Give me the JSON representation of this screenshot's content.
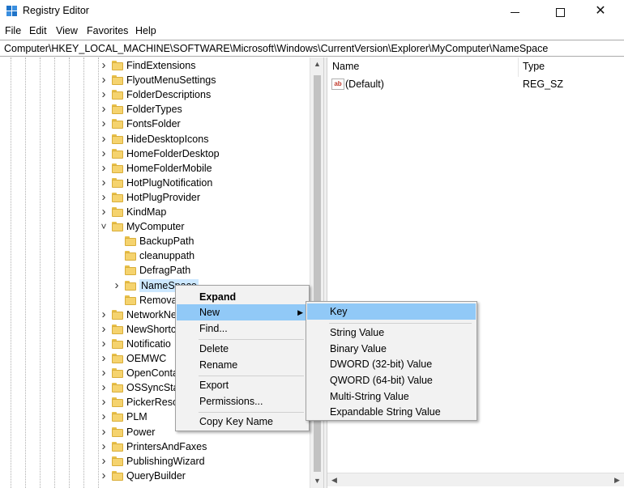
{
  "window": {
    "title": "Registry Editor",
    "minimize": "—",
    "maximize": "☐",
    "close": "✕"
  },
  "menu": [
    "File",
    "Edit",
    "View",
    "Favorites",
    "Help"
  ],
  "address": "Computer\\HKEY_LOCAL_MACHINE\\SOFTWARE\\Microsoft\\Windows\\CurrentVersion\\Explorer\\MyComputer\\NameSpace",
  "tree": {
    "items": [
      {
        "label": "FindExtensions",
        "expanded": false
      },
      {
        "label": "FlyoutMenuSettings",
        "expanded": false
      },
      {
        "label": "FolderDescriptions",
        "expanded": false
      },
      {
        "label": "FolderTypes",
        "expanded": false
      },
      {
        "label": "FontsFolder",
        "expanded": false
      },
      {
        "label": "HideDesktopIcons",
        "expanded": false
      },
      {
        "label": "HomeFolderDesktop",
        "expanded": false
      },
      {
        "label": "HomeFolderMobile",
        "expanded": false
      },
      {
        "label": "HotPlugNotification",
        "expanded": false
      },
      {
        "label": "HotPlugProvider",
        "expanded": false
      },
      {
        "label": "KindMap",
        "expanded": false
      },
      {
        "label": "MyComputer",
        "expanded": true
      },
      {
        "label": "BackupPath",
        "child": true
      },
      {
        "label": "cleanuppath",
        "child": true
      },
      {
        "label": "DefragPath",
        "child": true
      },
      {
        "label": "NameSpace",
        "child": true,
        "selected": true
      },
      {
        "label": "Remova",
        "child": true
      },
      {
        "label": "NetworkNe",
        "expanded": false
      },
      {
        "label": "NewShortc",
        "expanded": false
      },
      {
        "label": "Notificatio",
        "expanded": false
      },
      {
        "label": "OEMWC",
        "expanded": false
      },
      {
        "label": "OpenConta",
        "expanded": false
      },
      {
        "label": "OSSyncSta",
        "expanded": false
      },
      {
        "label": "PickerReso",
        "expanded": false
      },
      {
        "label": "PLM",
        "expanded": false
      },
      {
        "label": "Power",
        "expanded": false
      },
      {
        "label": "PrintersAndFaxes",
        "expanded": false
      },
      {
        "label": "PublishingWizard",
        "expanded": false
      },
      {
        "label": "QueryBuilder",
        "expanded": false
      }
    ]
  },
  "values": {
    "columns": {
      "name": "Name",
      "type": "Type"
    },
    "rows": [
      {
        "icon": "ab",
        "name": "(Default)",
        "type": "REG_SZ"
      }
    ]
  },
  "context_menu": {
    "items": [
      "Expand",
      "New",
      "Find...",
      "Delete",
      "Rename",
      "Export",
      "Permissions...",
      "Copy Key Name"
    ]
  },
  "new_submenu": {
    "items": [
      "Key",
      "String Value",
      "Binary Value",
      "DWORD (32-bit) Value",
      "QWORD (64-bit) Value",
      "Multi-String Value",
      "Expandable String Value"
    ]
  },
  "colors": {
    "highlight": "#91c9f7",
    "selection": "#cce8ff",
    "folder": "#f5d36e"
  }
}
